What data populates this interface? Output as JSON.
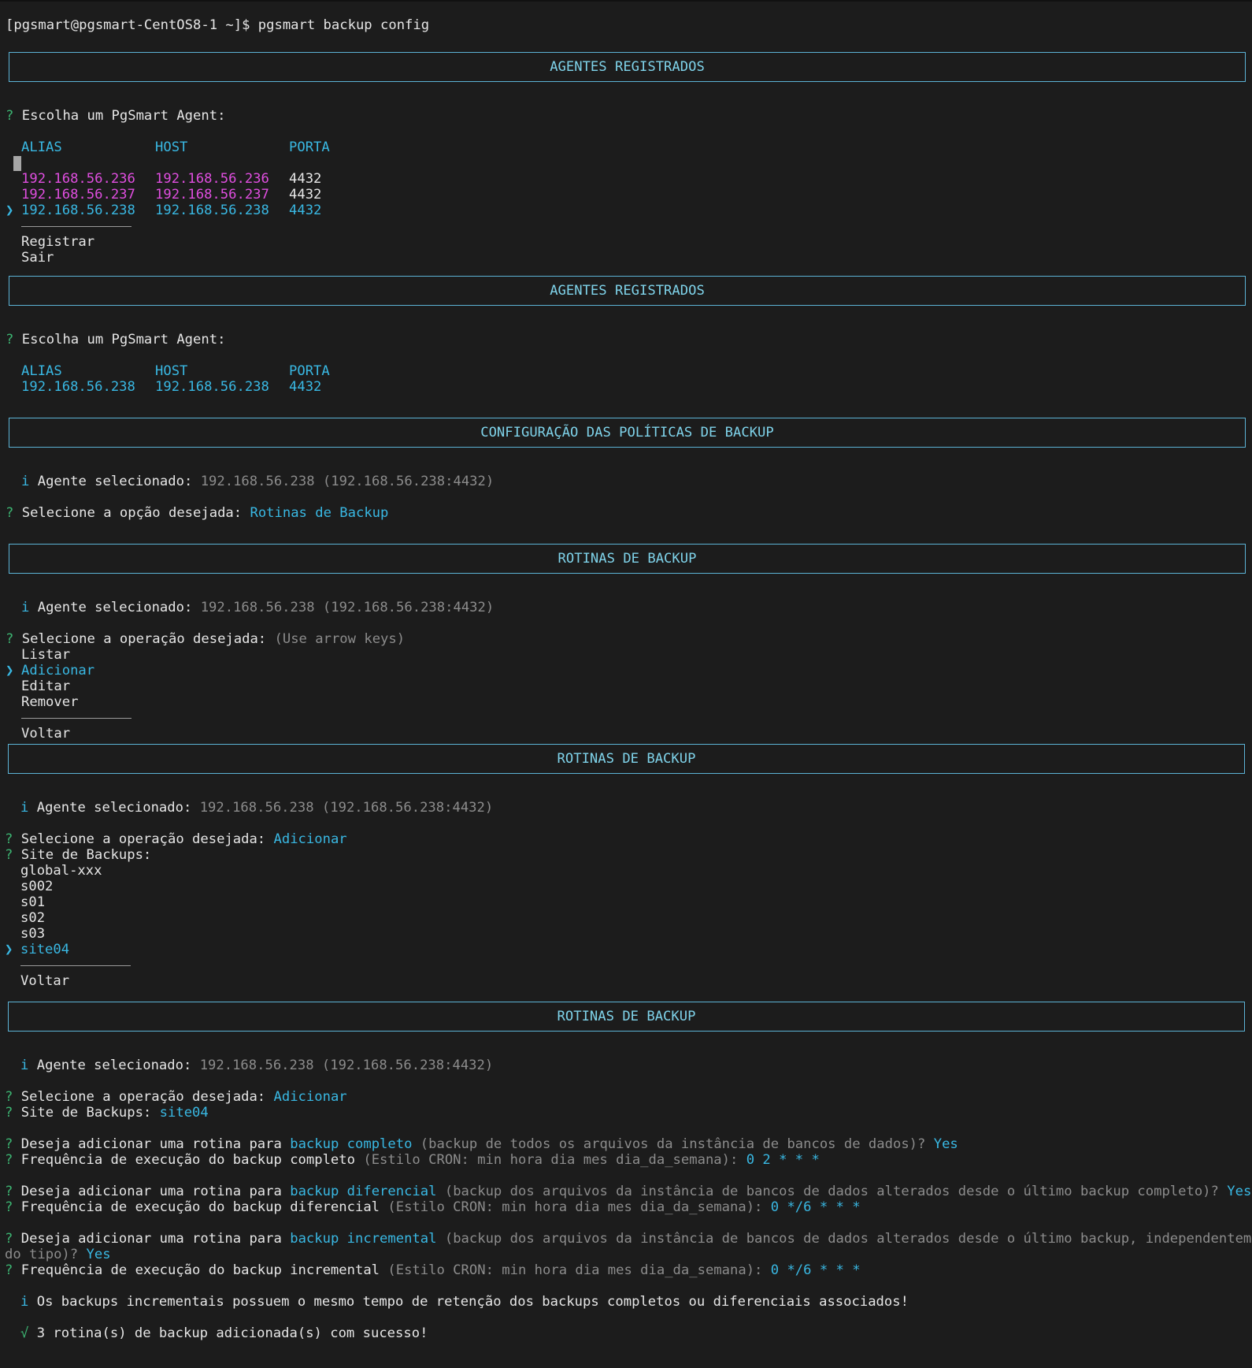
{
  "prompt": "[pgsmart@pgsmart-CentOS8-1 ~]$ pgsmart backup config",
  "q": "?",
  "arrow": "❯",
  "info": "i",
  "check": "√",
  "b1": {
    "banner": "AGENTES REGISTRADOS",
    "question": "Escolha um PgSmart Agent:",
    "headers": {
      "alias": "ALIAS",
      "host": "HOST",
      "porta": "PORTA"
    },
    "rows": [
      {
        "alias": "192.168.56.236",
        "host": "192.168.56.236",
        "porta": "4432"
      },
      {
        "alias": "192.168.56.237",
        "host": "192.168.56.237",
        "porta": "4432"
      },
      {
        "alias": "192.168.56.238",
        "host": "192.168.56.238",
        "porta": "4432"
      }
    ],
    "extra": [
      "Registrar",
      "Sair"
    ]
  },
  "b2": {
    "banner": "AGENTES REGISTRADOS",
    "question": "Escolha um PgSmart Agent:",
    "headers": {
      "alias": "ALIAS",
      "host": "HOST",
      "porta": "PORTA"
    },
    "row": {
      "alias": "192.168.56.238",
      "host": "192.168.56.238",
      "porta": "4432"
    }
  },
  "b3": {
    "banner": "CONFIGURAÇÃO DAS POLÍTICAS DE BACKUP",
    "agent_label": "Agente selecionado:",
    "agent_value": "192.168.56.238 (192.168.56.238:4432)",
    "question": "Selecione a opção desejada:",
    "answer": "Rotinas de Backup"
  },
  "b4": {
    "banner": "ROTINAS DE BACKUP",
    "agent_label": "Agente selecionado:",
    "agent_value": "192.168.56.238 (192.168.56.238:4432)",
    "question": "Selecione a operação desejada:",
    "hint": "(Use arrow keys)",
    "options": [
      "Listar",
      "Adicionar",
      "Editar",
      "Remover"
    ],
    "back": "Voltar"
  },
  "b5": {
    "banner": "ROTINAS DE BACKUP",
    "agent_label": "Agente selecionado:",
    "agent_value": "192.168.56.238 (192.168.56.238:4432)",
    "question": "Selecione a operação desejada:",
    "answer": "Adicionar",
    "site_question": "Site de Backups:",
    "sites": [
      "global-xxx",
      "s002",
      "s01",
      "s02",
      "s03",
      "site04"
    ],
    "back": "Voltar"
  },
  "b6": {
    "banner": "ROTINAS DE BACKUP",
    "agent_label": "Agente selecionado:",
    "agent_value": "192.168.56.238 (192.168.56.238:4432)",
    "question": "Selecione a operação desejada:",
    "answer": "Adicionar",
    "site_question": "Site de Backups:",
    "site_answer": "site04",
    "add_prefix": "Deseja adicionar uma rotina para",
    "full_kw": "backup completo",
    "full_desc": "(backup de todos os arquivos da instância de bancos de dados)?",
    "yes": "Yes",
    "freq_full": "Frequência de execução do backup completo",
    "cron_hint": "(Estilo CRON: min hora dia mes dia_da_semana):",
    "cron_full": "0 2 * * *",
    "diff_kw": "backup diferencial",
    "diff_desc": "(backup dos arquivos da instância de bancos de dados alterados desde o último backup completo)?",
    "freq_diff": "Frequência de execução do backup diferencial",
    "cron_diff": "0 */6 * * *",
    "inc_kw": "backup incremental",
    "inc_desc1": "(backup dos arquivos da instância de bancos de dados alterados desde o último backup, independentemente",
    "inc_desc2": "do tipo)?",
    "freq_inc": "Frequência de execução do backup incremental",
    "cron_inc": "0 */6 * * *",
    "note": "Os backups incrementais possuem o mesmo tempo de retenção dos backups completos ou diferenciais associados!",
    "success": "3 rotina(s) de backup adicionada(s) com sucesso!"
  }
}
